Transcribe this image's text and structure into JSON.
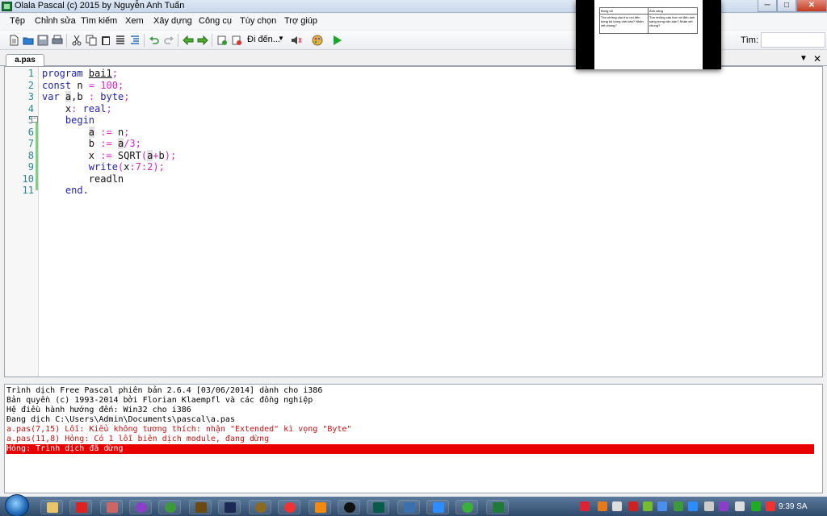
{
  "window": {
    "title": "Olala Pascal (c) 2015 by Nguyễn Anh Tuấn",
    "min": "─",
    "max": "□",
    "close": "✕"
  },
  "preview": {
    "col1": "Bóng tối",
    "col2": "Ánh sáng",
    "cell1": "Tìm những câu thơ nói đến bóng tối trong văn bản? Nhận xét chung?",
    "cell2": "Tìm những câu thơ nói đến ánh sáng trong văn bản? Nhận xét chung?"
  },
  "menu": [
    "Tệp",
    "Chỉnh sửa",
    "Tìm kiếm",
    "Xem",
    "Xây dựng",
    "Công cụ",
    "Tùy chọn",
    "Trợ giúp"
  ],
  "toolbar": {
    "goto_label": "Đi đến...",
    "find_label": "Tìm:",
    "find_value": ""
  },
  "tabs": {
    "active": "a.pas"
  },
  "editor": {
    "line_numbers": [
      "1",
      "2",
      "3",
      "4",
      "5",
      "6",
      "7",
      "8",
      "9",
      "10",
      "11"
    ],
    "lines": [
      "program bai1;",
      "const n = 100;",
      "var a,b : byte;",
      "    x: real;",
      "    begin",
      "        a := n;",
      "        b := a/3;",
      "        x := SQRT(a+b);",
      "        write(x:7:2);",
      "        readln",
      "    end."
    ]
  },
  "messages": [
    "Trình dịch Free Pascal phiên bản 2.6.4 [03/06/2014] dành cho i386",
    "Bản quyền (c) 1993-2014 bởi Florian Klaempfl và các đồng nghiệp",
    "Hệ điều hành hướng đến: Win32 cho i386",
    "Đang dịch C:\\Users\\Admin\\Documents\\pascal\\a.pas",
    "a.pas(7,15) Lỗi: Kiểu không tương thích: nhận \"Extended\" kì vọng \"Byte\"",
    "a.pas(11,8) Hỏng: Có 1 lỗi biên dịch module, đang dừng",
    "Hỏng: Trình dịch đã dừng"
  ],
  "taskbar": {
    "clock": "9:39 SA"
  },
  "colors": {
    "keyword": "#1f1fb5",
    "number": "#d726c8",
    "line_number": "#2b8a8a",
    "error_text": "#d01010",
    "error_bar": "#e80000"
  }
}
